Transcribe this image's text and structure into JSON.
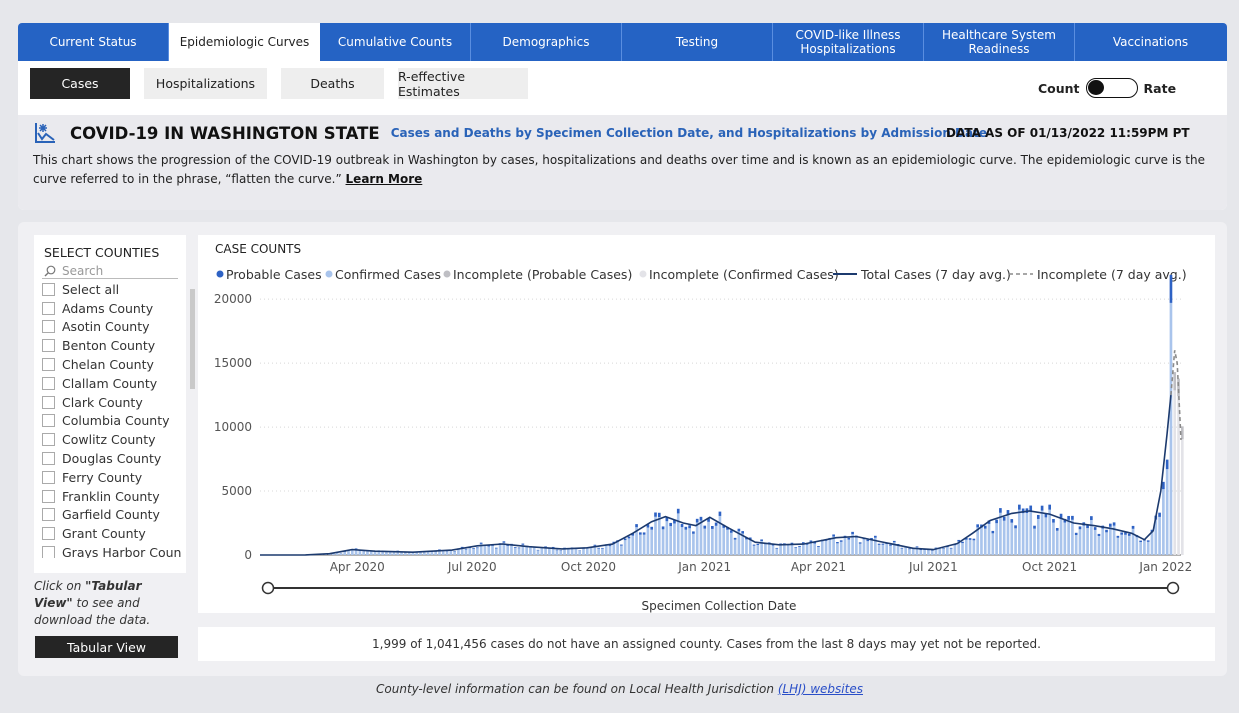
{
  "tabs": [
    {
      "label": "Current Status",
      "active": false
    },
    {
      "label": "Epidemiologic Curves",
      "active": true
    },
    {
      "label": "Cumulative Counts",
      "active": false
    },
    {
      "label": "Demographics",
      "active": false
    },
    {
      "label": "Testing",
      "active": false
    },
    {
      "label": "COVID-like Illness Hospitalizations",
      "active": false
    },
    {
      "label": "Healthcare System Readiness",
      "active": false
    },
    {
      "label": "Vaccinations",
      "active": false
    }
  ],
  "subtabs": [
    {
      "label": "Cases",
      "active": true
    },
    {
      "label": "Hospitalizations",
      "active": false
    },
    {
      "label": "Deaths",
      "active": false
    },
    {
      "label": "R-effective Estimates",
      "active": false
    }
  ],
  "toggle": {
    "left_label": "Count",
    "right_label": "Rate",
    "selected": "Count"
  },
  "header": {
    "title": "COVID-19 IN WASHINGTON STATE",
    "subtitle": "Cases and Deaths by Specimen Collection Date, and Hospitalizations by Admission Date",
    "as_of": "DATA AS OF 01/13/2022 11:59PM PT",
    "description": " This chart shows the progression of the COVID-19 outbreak in Washington by cases, hospitalizations and deaths over time and is known as an epidemiologic curve. The epidemiologic curve is the curve referred to in the phrase, “flatten the curve.”",
    "learn_more": "Learn More"
  },
  "counties": {
    "header": "SELECT COUNTIES",
    "search_placeholder": "Search",
    "items": [
      "Select all",
      "Adams County",
      "Asotin County",
      "Benton County",
      "Chelan County",
      "Clallam County",
      "Clark County",
      "Columbia County",
      "Cowlitz County",
      "Douglas County",
      "Ferry County",
      "Franklin County",
      "Garfield County",
      "Grant County",
      "Grays Harbor County"
    ]
  },
  "tabular": {
    "note_pre": "Click on ",
    "note_bold": "\"Tabular View\"",
    "note_post": " to see and download the data.",
    "button": "Tabular View"
  },
  "footnote": "1,999 of 1,041,456 cases do not have an assigned county. Cases from the last 8 days may yet not be reported.",
  "lhj": {
    "text": "County-level information can be found on Local Health Jurisdiction ",
    "link": "(LHJ) websites"
  },
  "colors": {
    "tab_blue": "#2563c4",
    "probable": "#2e62c4",
    "confirmed": "#a9c4ec",
    "incomplete_probable": "#bfbfc4",
    "incomplete_confirmed": "#e3e3e8",
    "total_line": "#1c3a6e",
    "incomplete_line": "#8a8a8a"
  },
  "chart_data": {
    "type": "bar",
    "title": "CASE COUNTS",
    "xlabel": "Specimen Collection Date",
    "ylabel": "",
    "ylim": [
      0,
      21500
    ],
    "yticks": [
      0,
      5000,
      10000,
      15000,
      20000
    ],
    "x_tick_labels": [
      "Apr 2020",
      "Jul 2020",
      "Oct 2020",
      "Jan 2021",
      "Apr 2021",
      "Jul 2021",
      "Oct 2021",
      "Jan 2022"
    ],
    "x_ticks": [
      "2020-04-01",
      "2020-07-01",
      "2020-10-01",
      "2021-01-01",
      "2021-04-01",
      "2021-07-01",
      "2021-10-01",
      "2022-01-01"
    ],
    "x_range": [
      "2020-01-15",
      "2022-01-13"
    ],
    "grid": true,
    "legend": {
      "position": "top",
      "entries": [
        {
          "label": "Probable Cases",
          "kind": "dot",
          "color": "#2e62c4"
        },
        {
          "label": "Confirmed Cases",
          "kind": "dot",
          "color": "#a9c4ec"
        },
        {
          "label": "Incomplete (Probable Cases)",
          "kind": "dot",
          "color": "#bfbfc4"
        },
        {
          "label": "Incomplete (Confirmed Cases)",
          "kind": "dot",
          "color": "#e3e3e8"
        },
        {
          "label": "Total Cases (7 day avg.)",
          "kind": "line",
          "color": "#1c3a6e"
        },
        {
          "label": "Incomplete (7 day avg.)",
          "kind": "dash",
          "color": "#8a8a8a"
        }
      ]
    },
    "series": [
      {
        "name": "Total Cases (7 day avg.)",
        "points": [
          [
            "2020-01-15",
            0
          ],
          [
            "2020-02-20",
            5
          ],
          [
            "2020-03-10",
            100
          ],
          [
            "2020-03-28",
            420
          ],
          [
            "2020-04-15",
            300
          ],
          [
            "2020-05-15",
            220
          ],
          [
            "2020-06-15",
            380
          ],
          [
            "2020-07-05",
            720
          ],
          [
            "2020-07-25",
            860
          ],
          [
            "2020-08-15",
            650
          ],
          [
            "2020-09-10",
            480
          ],
          [
            "2020-09-30",
            560
          ],
          [
            "2020-10-20",
            850
          ],
          [
            "2020-11-05",
            1700
          ],
          [
            "2020-11-20",
            2600
          ],
          [
            "2020-12-01",
            3000
          ],
          [
            "2020-12-15",
            2500
          ],
          [
            "2020-12-25",
            2300
          ],
          [
            "2021-01-05",
            2950
          ],
          [
            "2021-01-20",
            2100
          ],
          [
            "2021-02-10",
            1000
          ],
          [
            "2021-03-01",
            800
          ],
          [
            "2021-03-20",
            850
          ],
          [
            "2021-04-15",
            1350
          ],
          [
            "2021-05-01",
            1450
          ],
          [
            "2021-05-20",
            1050
          ],
          [
            "2021-06-15",
            520
          ],
          [
            "2021-07-01",
            420
          ],
          [
            "2021-07-20",
            900
          ],
          [
            "2021-08-01",
            1700
          ],
          [
            "2021-08-15",
            2700
          ],
          [
            "2021-09-01",
            3250
          ],
          [
            "2021-09-15",
            3450
          ],
          [
            "2021-10-01",
            3200
          ],
          [
            "2021-10-20",
            2500
          ],
          [
            "2021-11-05",
            2300
          ],
          [
            "2021-11-20",
            2050
          ],
          [
            "2021-12-05",
            1700
          ],
          [
            "2021-12-15",
            1200
          ],
          [
            "2021-12-22",
            1900
          ],
          [
            "2021-12-28",
            5000
          ],
          [
            "2022-01-02",
            9500
          ],
          [
            "2022-01-05",
            12500
          ]
        ]
      },
      {
        "name": "Incomplete (7 day avg.)",
        "points": [
          [
            "2022-01-05",
            12500
          ],
          [
            "2022-01-08",
            16000
          ],
          [
            "2022-01-10",
            15000
          ],
          [
            "2022-01-13",
            9000
          ]
        ]
      }
    ],
    "bars": {
      "period_days": 3,
      "confirmed_share": 0.9,
      "peak_value": 21900,
      "peak_date": "2022-01-04",
      "incomplete_start": "2022-01-06"
    },
    "range_slider": {
      "start": "2020-01-15",
      "end": "2022-01-13"
    }
  }
}
